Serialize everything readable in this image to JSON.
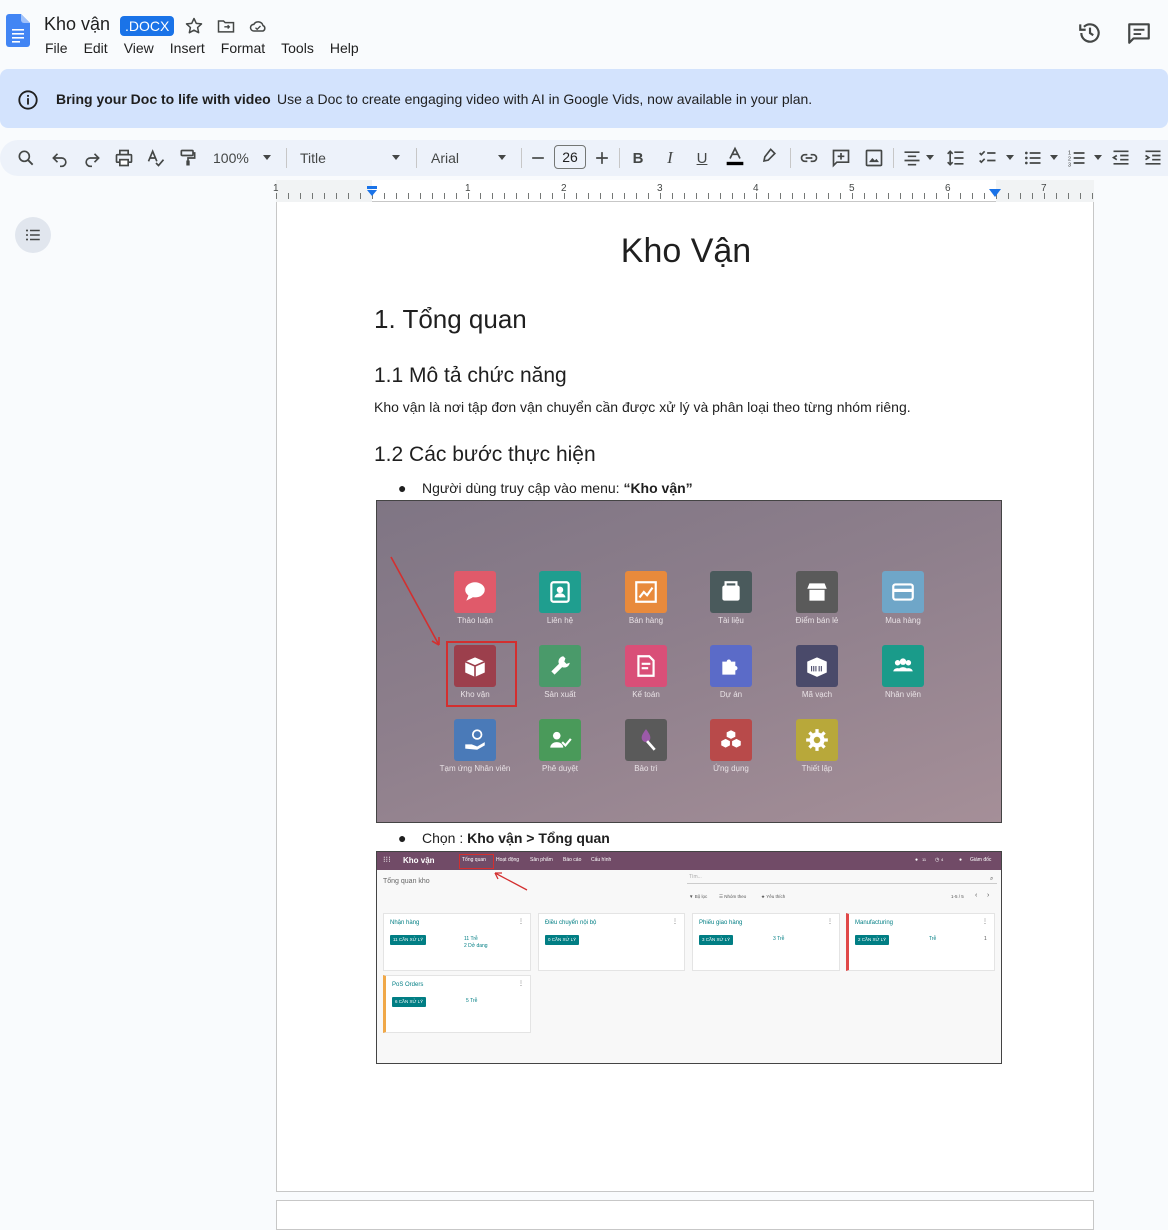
{
  "header": {
    "doc_title": "Kho vận",
    "badge": ".DOCX",
    "menu": [
      "File",
      "Edit",
      "View",
      "Insert",
      "Format",
      "Tools",
      "Help"
    ]
  },
  "banner": {
    "bold": "Bring your Doc to life with video",
    "text": "Use a Doc to create engaging video with AI in Google Vids, now available in your plan."
  },
  "toolbar": {
    "zoom": "100%",
    "style": "Title",
    "font": "Arial",
    "font_size": "26",
    "text_color": "#000000"
  },
  "ruler": {
    "numbers": [
      "1",
      "1",
      "2",
      "3",
      "4",
      "5",
      "6",
      "7"
    ]
  },
  "document": {
    "title": "Kho Vận",
    "h1": "1. Tổng quan",
    "h2_1": "1.1 Mô tả chức năng",
    "para": "Kho vận là nơi tập đơn vận chuyển cần được xử lý và phân loại theo từng nhóm riêng.",
    "h2_2": "1.2 Các bước thực hiện",
    "bullet1_prefix": "Người dùng truy cập vào menu: ",
    "bullet1_bold": "“Kho vận”",
    "bullet2_prefix": "Chọn : ",
    "bullet2_bold": "Kho vận > Tổng quan",
    "bullet_char": "●"
  },
  "screenshot1": {
    "apps": [
      {
        "label": "Thảo luận",
        "color": "#e05a6a"
      },
      {
        "label": "Liên hệ",
        "color": "#1f9e8f"
      },
      {
        "label": "Bán hàng",
        "color": "#e88a3c"
      },
      {
        "label": "Tài liệu",
        "color": "#4a5a5c"
      },
      {
        "label": "Điểm bán lẻ",
        "color": "#5a5a5a"
      },
      {
        "label": "Mua hàng",
        "color": "#6fa6c8"
      },
      {
        "label": "Kho vận",
        "color": "#9c3f4c"
      },
      {
        "label": "Sản xuất",
        "color": "#4a9a6a"
      },
      {
        "label": "Kế toán",
        "color": "#d94f78"
      },
      {
        "label": "Dự án",
        "color": "#5b6bc8"
      },
      {
        "label": "Mã vạch",
        "color": "#4a4a6a"
      },
      {
        "label": "Nhân viên",
        "color": "#1a9b8a"
      },
      {
        "label": "Tạm ứng Nhân viên",
        "color": "#4a7ab8"
      },
      {
        "label": "Phê duyệt",
        "color": "#4a9a5a"
      },
      {
        "label": "Bảo trì",
        "color": "#5a5a5a"
      },
      {
        "label": "Ứng dụng",
        "color": "#b84a4a"
      },
      {
        "label": "Thiết lập",
        "color": "#b8a83a"
      }
    ]
  },
  "screenshot2": {
    "brand": "Kho vận",
    "menu": [
      "Tổng quan",
      "Hoạt động",
      "Sản phẩm",
      "Báo cáo",
      "Cấu hình"
    ],
    "breadcrumb": "Tổng quan kho",
    "search_placeholder": "Tìm...",
    "filters": [
      "▼ Bộ lọc",
      "☰ Nhóm theo",
      "★ Yêu thích"
    ],
    "pager": "1-5 / 5",
    "user": "Giám đốc",
    "msg_count": "11",
    "activity_count": "4",
    "cards": [
      {
        "title": "Nhận hàng",
        "btn": "11 CẦN XỬ LÝ",
        "meta1": "11 Trễ",
        "meta2": "2 Dở dang"
      },
      {
        "title": "Điều chuyển nội bộ",
        "btn": "0 CẦN XỬ LÝ",
        "meta1": "",
        "meta2": ""
      },
      {
        "title": "Phiếu giao hàng",
        "btn": "3 CẦN XỬ LÝ",
        "meta1": "3 Trễ",
        "meta2": ""
      },
      {
        "title": "Manufacturing",
        "btn": "2 CẦN XỬ LÝ",
        "meta1": "Trễ",
        "meta2": "1"
      },
      {
        "title": "PoS Orders",
        "btn": "6 CẦN XỬ LÝ",
        "meta1": "5 Trễ",
        "meta2": ""
      }
    ]
  }
}
